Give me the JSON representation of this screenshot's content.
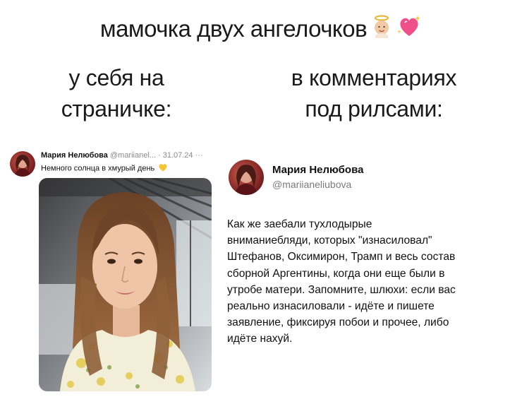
{
  "header": {
    "title": "мамочка двух ангелочков"
  },
  "columns": {
    "left_heading": [
      "у себя на",
      "страничке:"
    ],
    "right_heading": [
      "в комментариях",
      "под рилсами:"
    ]
  },
  "left_post": {
    "author_name": "Мария Нелюбова",
    "handle_and_date": "@mariianel... · 31.07.24",
    "more": "···",
    "text": "Немного солнца в хмурый день"
  },
  "right_post": {
    "author_name": "Мария Нелюбова",
    "handle": "@mariianeliubova",
    "text_lines": [
      "Как же заебали тухлодырые",
      "вниманиебляди, которых \"изнасиловал\"",
      "Штефанов, Оксимирон, Трамп и весь состав",
      "сборной Аргентины, когда они еще были в",
      "утробе матери. Запомните, шлюхи: если вас",
      "реально изнасиловали - идёте и пишете",
      "заявление, фиксируя побои и прочее, либо",
      "идёте нахуй."
    ]
  },
  "icons": {
    "title_emojis": [
      "angel-baby-emoji",
      "sparkling-heart-emoji"
    ],
    "post_emoji": "yellow-heart-emoji"
  },
  "colors": {
    "handle_gray": "#7b7b7b",
    "heart_pink": "#f0508a",
    "yellow_heart": "#f7c531"
  }
}
